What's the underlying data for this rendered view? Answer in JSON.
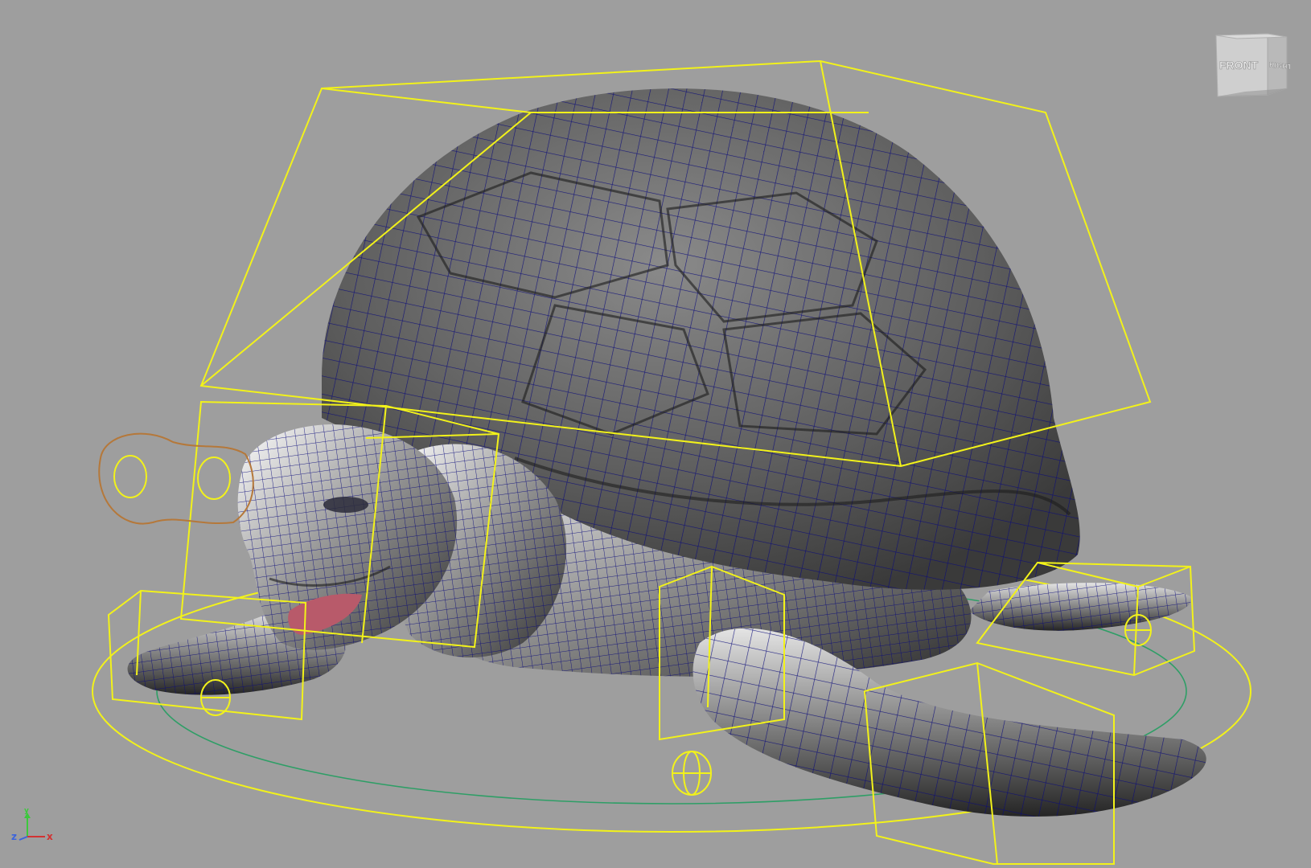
{
  "viewport": {
    "background": "#9e9e9e",
    "wireframe_color": "#0b0b7a",
    "control_color": "#f2f21a",
    "secondary_control_color": "#b5783a",
    "ground_ring_color": "#2e9e66"
  },
  "viewcube": {
    "front_label": "FRONT",
    "right_label": "RIGHT"
  },
  "axis_indicator": {
    "x_label": "x",
    "y_label": "y",
    "z_label": "z",
    "x_color": "#d23232",
    "y_color": "#3cc83c",
    "z_color": "#3c64dc"
  },
  "model": {
    "subject": "turtle",
    "shading": "wireframe-on-shaded"
  }
}
